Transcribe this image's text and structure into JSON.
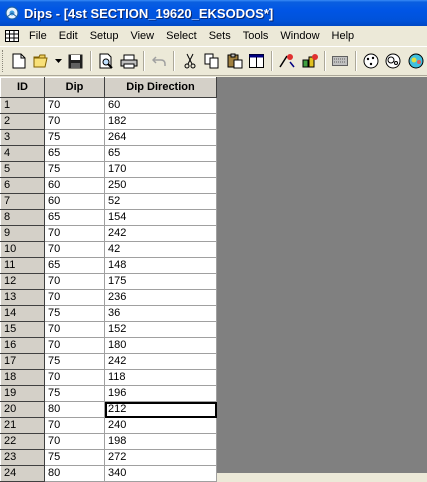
{
  "window": {
    "title": "Dips - [4st SECTION_19620_EKSODOS*]"
  },
  "menu": [
    "File",
    "Edit",
    "Setup",
    "View",
    "Select",
    "Sets",
    "Tools",
    "Window",
    "Help"
  ],
  "table": {
    "headers": [
      "ID",
      "Dip",
      "Dip Direction"
    ],
    "rows": [
      [
        "1",
        "70",
        "60"
      ],
      [
        "2",
        "70",
        "182"
      ],
      [
        "3",
        "75",
        "264"
      ],
      [
        "4",
        "65",
        "65"
      ],
      [
        "5",
        "75",
        "170"
      ],
      [
        "6",
        "60",
        "250"
      ],
      [
        "7",
        "60",
        "52"
      ],
      [
        "8",
        "65",
        "154"
      ],
      [
        "9",
        "70",
        "242"
      ],
      [
        "10",
        "70",
        "42"
      ],
      [
        "11",
        "65",
        "148"
      ],
      [
        "12",
        "70",
        "175"
      ],
      [
        "13",
        "70",
        "236"
      ],
      [
        "14",
        "75",
        "36"
      ],
      [
        "15",
        "70",
        "152"
      ],
      [
        "16",
        "70",
        "180"
      ],
      [
        "17",
        "75",
        "242"
      ],
      [
        "18",
        "70",
        "118"
      ],
      [
        "19",
        "75",
        "196"
      ],
      [
        "20",
        "80",
        "212"
      ],
      [
        "21",
        "70",
        "240"
      ],
      [
        "22",
        "70",
        "198"
      ],
      [
        "23",
        "75",
        "272"
      ],
      [
        "24",
        "80",
        "340"
      ]
    ],
    "selected_row": 20
  },
  "toolbar_icons": [
    "new-file-icon",
    "open-folder-icon",
    "dropdown-arrow-icon",
    "save-icon",
    "print-preview-icon",
    "print-icon",
    "undo-icon",
    "cut-icon",
    "copy-icon",
    "paste-icon",
    "table-icon",
    "pick-tool-icon",
    "sets-tool-icon",
    "keyboard-icon",
    "stereonet-icon",
    "contour-icon",
    "rosette-icon"
  ]
}
